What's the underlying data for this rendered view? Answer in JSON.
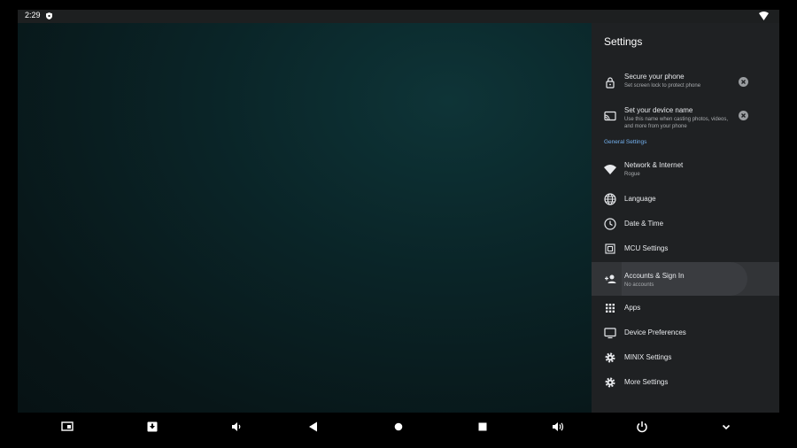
{
  "status_bar": {
    "time": "2:29"
  },
  "settings": {
    "title": "Settings",
    "suggestions": [
      {
        "title": "Secure your phone",
        "subtitle": "Set screen lock to protect phone",
        "icon": "lock-icon"
      },
      {
        "title": "Set your device name",
        "subtitle": "Use this name when casting photos, videos, and more from your phone",
        "icon": "cast-icon"
      }
    ],
    "section_header": "General Settings",
    "items": [
      {
        "label": "Network & Internet",
        "sub": "Rogue",
        "icon": "wifi-icon"
      },
      {
        "label": "Language",
        "icon": "globe-icon"
      },
      {
        "label": "Date & Time",
        "icon": "clock-icon"
      },
      {
        "label": "MCU Settings",
        "icon": "chip-icon"
      },
      {
        "label": "Accounts & Sign In",
        "sub": "No accounts",
        "icon": "person-add-icon"
      },
      {
        "label": "Apps",
        "icon": "apps-grid-icon"
      },
      {
        "label": "Device Preferences",
        "icon": "tv-icon"
      },
      {
        "label": "MINIX Settings",
        "icon": "gear-icon"
      },
      {
        "label": "More Settings",
        "icon": "gear-icon"
      }
    ]
  },
  "navbar_icons": [
    "screenshot-icon",
    "download-icon",
    "volume-down-icon",
    "back-icon",
    "home-icon",
    "recents-icon",
    "volume-up-icon",
    "power-icon",
    "chevron-down-icon"
  ],
  "colors": {
    "accent": "#74b1ef",
    "panel": "#1f2123",
    "focus": "#323437",
    "wallpaper": "#0c1b1c"
  }
}
